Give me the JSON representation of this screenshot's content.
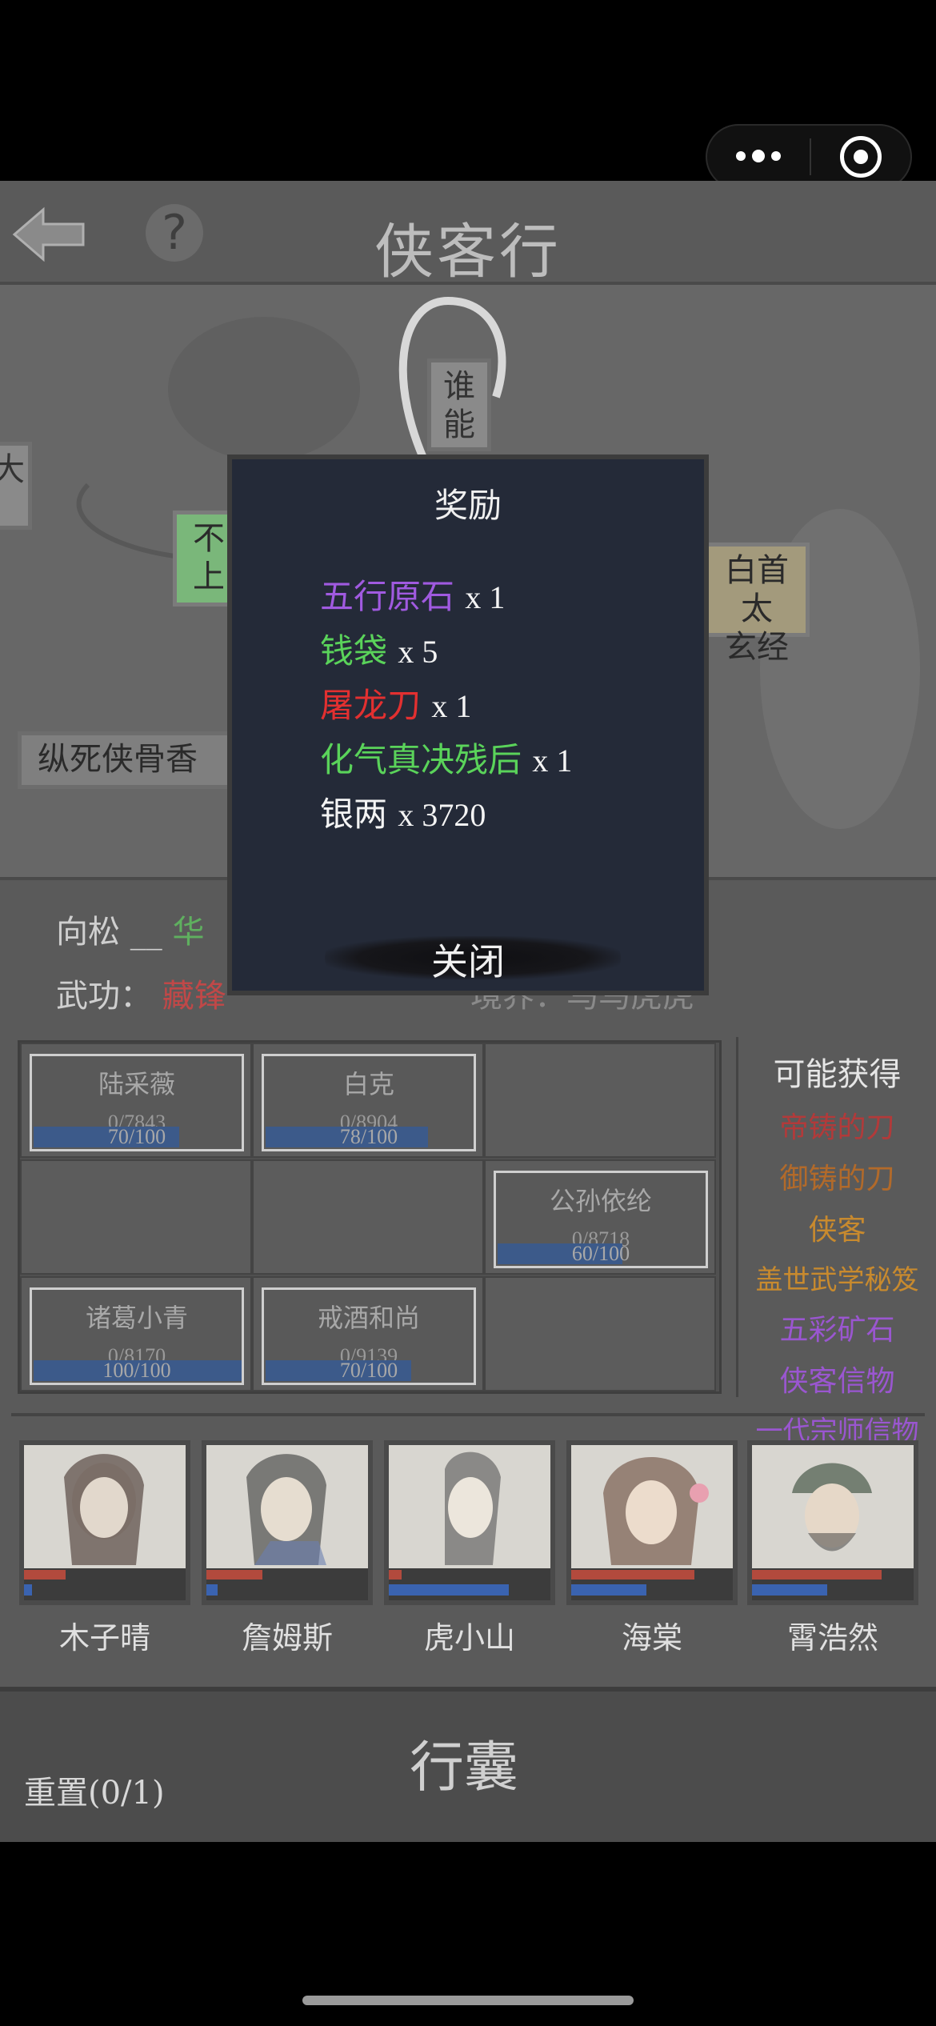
{
  "header": {
    "title": "侠客行",
    "help_label": "?"
  },
  "map": {
    "node_left_partial": "大",
    "node_top": [
      "谁",
      "能"
    ],
    "node_green": [
      "不",
      "上"
    ],
    "node_right": [
      "白首太",
      "玄经"
    ],
    "node_bottom_left": "纵死侠骨香"
  },
  "status": {
    "line1_prefix": "向松",
    "line1_sep": "__",
    "line1_value": "华",
    "line2_label": "武功：",
    "line2_value": "藏锋",
    "line2_right": "境界：马马虎虎"
  },
  "grid": {
    "cards": [
      {
        "name": "陆采薇",
        "value": "0/7843",
        "bar": "70/100",
        "ratio": 0.7
      },
      {
        "name": "白克",
        "value": "0/8904",
        "bar": "78/100",
        "ratio": 0.78
      },
      {
        "name": "公孙依纶",
        "value": "0/8718",
        "bar": "60/100",
        "ratio": 0.6
      },
      {
        "name": "诸葛小青",
        "value": "0/8170",
        "bar": "100/100",
        "ratio": 1.0
      },
      {
        "name": "戒酒和尚",
        "value": "0/9139",
        "bar": "70/100",
        "ratio": 0.7
      }
    ]
  },
  "possible_rewards": {
    "title": "可能获得",
    "items": [
      {
        "label": "帝铸的刀",
        "color": "#b23a3a"
      },
      {
        "label": "御铸的刀",
        "color": "#b26a2a"
      },
      {
        "label": "侠客",
        "color": "#c88a2e"
      },
      {
        "label": "盖世武学秘笈",
        "color": "#c88a2e"
      },
      {
        "label": "五彩矿石",
        "color": "#9a56d0"
      },
      {
        "label": "侠客信物",
        "color": "#9a56d0"
      },
      {
        "label": "一代宗师信物",
        "color": "#9a56d0"
      }
    ]
  },
  "characters": [
    {
      "name": "木子晴",
      "hp": 0.26,
      "mp": 0.05
    },
    {
      "name": "詹姆斯",
      "hp": 0.34,
      "mp": 0.07
    },
    {
      "name": "虎小山",
      "hp": 0.08,
      "mp": 0.74
    },
    {
      "name": "海棠",
      "hp": 0.76,
      "mp": 0.46
    },
    {
      "name": "霄浩然",
      "hp": 0.8,
      "mp": 0.46
    }
  ],
  "bottom": {
    "bag_label": "行囊",
    "reset_label": "重置(0/1)"
  },
  "modal": {
    "title": "奖励",
    "rewards": [
      {
        "name": "五行原石",
        "qty": "x 1",
        "color": "#a05ae0"
      },
      {
        "name": "钱袋",
        "qty": "x 5",
        "color": "#5ad35a"
      },
      {
        "name": "屠龙刀",
        "qty": "x 1",
        "color": "#e23030"
      },
      {
        "name": "化气真决残后",
        "qty": "x 1",
        "color": "#5ad35a"
      },
      {
        "name": "银两",
        "qty": "x 3720",
        "color": "#f4f4f4"
      }
    ],
    "close_label": "关闭"
  }
}
